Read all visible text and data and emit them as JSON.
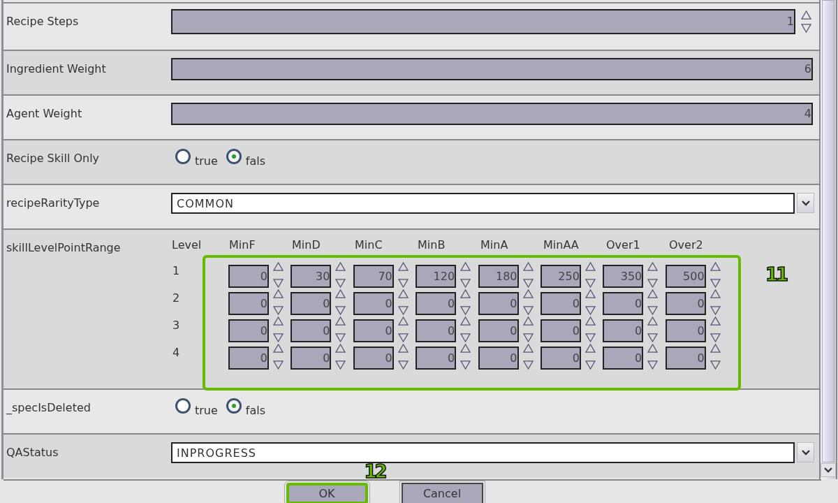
{
  "form": {
    "rows": [
      {
        "kind": "spinner",
        "label": "Recipe Steps",
        "value": "1"
      },
      {
        "kind": "number",
        "label": "Ingredient Weight",
        "value": "6"
      },
      {
        "kind": "number",
        "label": "Agent Weight",
        "value": "4"
      },
      {
        "kind": "radio",
        "label": "Recipe Skill Only",
        "options": [
          {
            "label": "true",
            "selected": false
          },
          {
            "label": "fals",
            "selected": true
          }
        ]
      },
      {
        "kind": "dropdown",
        "label": "recipeRarityType",
        "value": "COMMON"
      },
      {
        "kind": "grid",
        "label": "skillLevelPointRange",
        "corner": "Level",
        "columns": [
          "MinF",
          "MinD",
          "MinC",
          "MinB",
          "MinA",
          "MinAA",
          "Over1",
          "Over2"
        ],
        "annotation": "11",
        "rows": [
          {
            "level": "1",
            "values": [
              "0",
              "30",
              "70",
              "120",
              "180",
              "250",
              "350",
              "500"
            ]
          },
          {
            "level": "2",
            "values": [
              "0",
              "0",
              "0",
              "0",
              "0",
              "0",
              "0",
              "0"
            ]
          },
          {
            "level": "3",
            "values": [
              "0",
              "0",
              "0",
              "0",
              "0",
              "0",
              "0",
              "0"
            ]
          },
          {
            "level": "4",
            "values": [
              "0",
              "0",
              "0",
              "0",
              "0",
              "0",
              "0",
              "0"
            ]
          }
        ]
      },
      {
        "kind": "radio",
        "label": "_specIsDeleted",
        "options": [
          {
            "label": "true",
            "selected": false
          },
          {
            "label": "fals",
            "selected": true
          }
        ]
      },
      {
        "kind": "dropdown",
        "label": "QAStatus",
        "value": "INPROGRESS"
      }
    ]
  },
  "buttons": [
    {
      "label": "OK",
      "annotation": "12"
    },
    {
      "label": "Cancel"
    }
  ]
}
